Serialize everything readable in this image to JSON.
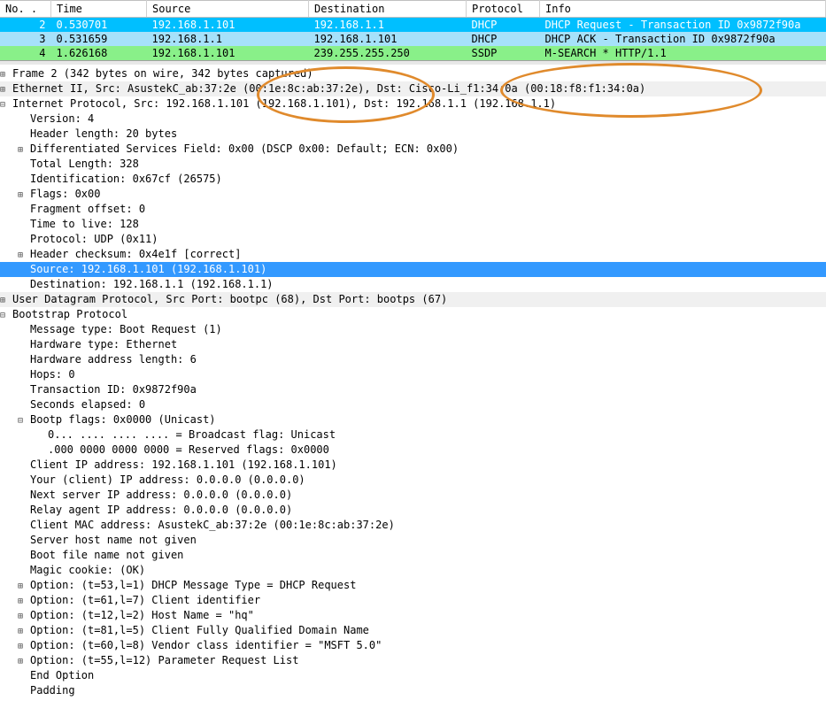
{
  "columns": {
    "no": "No. .",
    "time": "Time",
    "src": "Source",
    "dst": "Destination",
    "proto": "Protocol",
    "info": "Info"
  },
  "packets": [
    {
      "no": "2",
      "time": "0.530701",
      "src": "192.168.1.101",
      "dst": "192.168.1.1",
      "proto": "DHCP",
      "info": "DHCP Request  - Transaction ID 0x9872f90a",
      "style": "row-blue"
    },
    {
      "no": "3",
      "time": "0.531659",
      "src": "192.168.1.1",
      "dst": "192.168.1.101",
      "proto": "DHCP",
      "info": "DHCP ACK      - Transaction ID 0x9872f90a",
      "style": "row-lightblue"
    },
    {
      "no": "4",
      "time": "1.626168",
      "src": "192.168.1.101",
      "dst": "239.255.255.250",
      "proto": "SSDP",
      "info": "M-SEARCH * HTTP/1.1",
      "style": "row-green"
    }
  ],
  "details": [
    {
      "cls": "lvl1 exp",
      "txt": "Frame 2 (342 bytes on wire, 342 bytes captured)"
    },
    {
      "cls": "lvl1 exp alt",
      "txt": "Ethernet II, Src: AsustekC_ab:37:2e (00:1e:8c:ab:37:2e), Dst: Cisco-Li_f1:34:0a (00:18:f8:f1:34:0a)"
    },
    {
      "cls": "lvl1 col",
      "txt": "Internet Protocol, Src: 192.168.1.101 (192.168.1.101), Dst: 192.168.1.1 (192.168.1.1)"
    },
    {
      "cls": "lvl2",
      "txt": "Version: 4"
    },
    {
      "cls": "lvl2",
      "txt": "Header length: 20 bytes"
    },
    {
      "cls": "lvl2 exp",
      "txt": "Differentiated Services Field: 0x00 (DSCP 0x00: Default; ECN: 0x00)"
    },
    {
      "cls": "lvl2",
      "txt": "Total Length: 328"
    },
    {
      "cls": "lvl2",
      "txt": "Identification: 0x67cf (26575)"
    },
    {
      "cls": "lvl2 exp",
      "txt": "Flags: 0x00"
    },
    {
      "cls": "lvl2",
      "txt": "Fragment offset: 0"
    },
    {
      "cls": "lvl2",
      "txt": "Time to live: 128"
    },
    {
      "cls": "lvl2",
      "txt": "Protocol: UDP (0x11)"
    },
    {
      "cls": "lvl2 exp",
      "txt": "Header checksum: 0x4e1f [correct]"
    },
    {
      "cls": "lvl2 selected",
      "txt": "Source: 192.168.1.101 (192.168.1.101)"
    },
    {
      "cls": "lvl2",
      "txt": "Destination: 192.168.1.1 (192.168.1.1)"
    },
    {
      "cls": "lvl1 exp alt",
      "txt": "User Datagram Protocol, Src Port: bootpc (68), Dst Port: bootps (67)"
    },
    {
      "cls": "lvl1 col",
      "txt": "Bootstrap Protocol"
    },
    {
      "cls": "lvl2",
      "txt": "Message type: Boot Request (1)"
    },
    {
      "cls": "lvl2",
      "txt": "Hardware type: Ethernet"
    },
    {
      "cls": "lvl2",
      "txt": "Hardware address length: 6"
    },
    {
      "cls": "lvl2",
      "txt": "Hops: 0"
    },
    {
      "cls": "lvl2",
      "txt": "Transaction ID: 0x9872f90a"
    },
    {
      "cls": "lvl2",
      "txt": "Seconds elapsed: 0"
    },
    {
      "cls": "lvl2 col",
      "txt": "Bootp flags: 0x0000 (Unicast)"
    },
    {
      "cls": "lvl3",
      "txt": "0... .... .... .... = Broadcast flag: Unicast"
    },
    {
      "cls": "lvl3",
      "txt": ".000 0000 0000 0000 = Reserved flags: 0x0000"
    },
    {
      "cls": "lvl2",
      "txt": "Client IP address: 192.168.1.101 (192.168.1.101)"
    },
    {
      "cls": "lvl2",
      "txt": "Your (client) IP address: 0.0.0.0 (0.0.0.0)"
    },
    {
      "cls": "lvl2",
      "txt": "Next server IP address: 0.0.0.0 (0.0.0.0)"
    },
    {
      "cls": "lvl2",
      "txt": "Relay agent IP address: 0.0.0.0 (0.0.0.0)"
    },
    {
      "cls": "lvl2",
      "txt": "Client MAC address: AsustekC_ab:37:2e (00:1e:8c:ab:37:2e)"
    },
    {
      "cls": "lvl2",
      "txt": "Server host name not given"
    },
    {
      "cls": "lvl2",
      "txt": "Boot file name not given"
    },
    {
      "cls": "lvl2",
      "txt": "Magic cookie: (OK)"
    },
    {
      "cls": "lvl2 exp",
      "txt": "Option: (t=53,l=1) DHCP Message Type = DHCP Request"
    },
    {
      "cls": "lvl2 exp",
      "txt": "Option: (t=61,l=7) Client identifier"
    },
    {
      "cls": "lvl2 exp",
      "txt": "Option: (t=12,l=2) Host Name = \"hq\""
    },
    {
      "cls": "lvl2 exp",
      "txt": "Option: (t=81,l=5) Client Fully Qualified Domain Name"
    },
    {
      "cls": "lvl2 exp",
      "txt": "Option: (t=60,l=8) Vendor class identifier = \"MSFT 5.0\""
    },
    {
      "cls": "lvl2 exp",
      "txt": "Option: (t=55,l=12) Parameter Request List"
    },
    {
      "cls": "lvl2",
      "txt": "End Option"
    },
    {
      "cls": "lvl2",
      "txt": "Padding"
    }
  ]
}
